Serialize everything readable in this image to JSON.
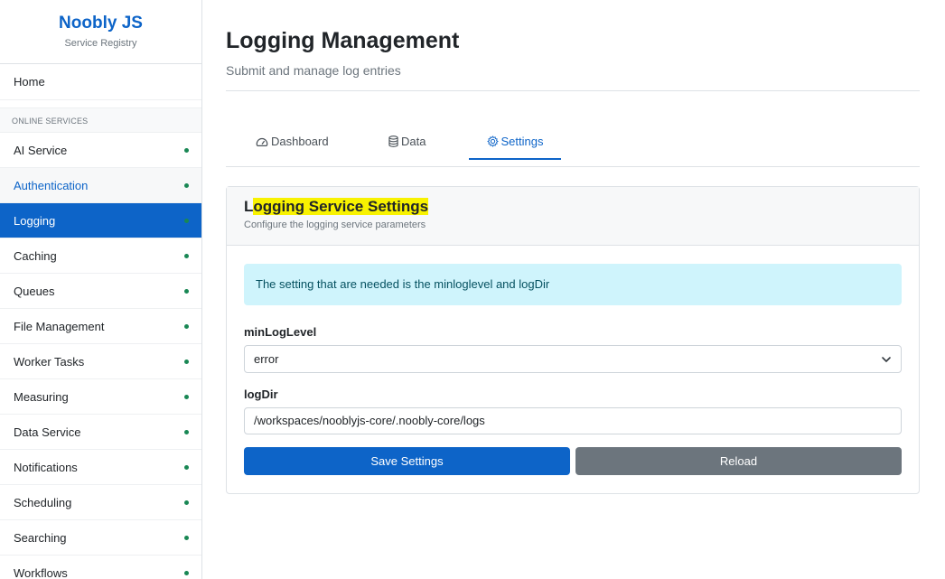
{
  "brand": {
    "title": "Noobly JS",
    "subtitle": "Service Registry"
  },
  "sidebar": {
    "home": "Home",
    "section": "ONLINE SERVICES",
    "items": [
      {
        "label": "AI Service",
        "status": "online"
      },
      {
        "label": "Authentication",
        "status": "online"
      },
      {
        "label": "Logging",
        "status": "online",
        "active": true
      },
      {
        "label": "Caching",
        "status": "online"
      },
      {
        "label": "Queues",
        "status": "online"
      },
      {
        "label": "File Management",
        "status": "online"
      },
      {
        "label": "Worker Tasks",
        "status": "online"
      },
      {
        "label": "Measuring",
        "status": "online"
      },
      {
        "label": "Data Service",
        "status": "online"
      },
      {
        "label": "Notifications",
        "status": "online"
      },
      {
        "label": "Scheduling",
        "status": "online"
      },
      {
        "label": "Searching",
        "status": "online"
      },
      {
        "label": "Workflows",
        "status": "online"
      }
    ]
  },
  "header": {
    "title": "Logging Management",
    "subtitle": "Submit and manage log entries"
  },
  "tabs": [
    {
      "label": "Dashboard",
      "icon": "gauge-icon"
    },
    {
      "label": "Data",
      "icon": "database-icon"
    },
    {
      "label": "Settings",
      "icon": "gear-icon",
      "active": true
    }
  ],
  "card": {
    "title_plain": "L",
    "title_highlight": "ogging Service Settings",
    "subtitle": "Configure the logging service parameters",
    "info": "The setting that are needed is the minloglevel and logDir",
    "fields": {
      "min_log_level": {
        "label": "minLogLevel",
        "value": "error"
      },
      "log_dir": {
        "label": "logDir",
        "value": "/workspaces/nooblyjs-core/.noobly-core/logs"
      }
    },
    "buttons": {
      "save": "Save Settings",
      "reload": "Reload"
    }
  },
  "colors": {
    "primary": "#0d64c8",
    "secondary": "#6c757d",
    "online": "#198754",
    "info_bg": "#cff4fc",
    "highlight": "#f8f200"
  }
}
